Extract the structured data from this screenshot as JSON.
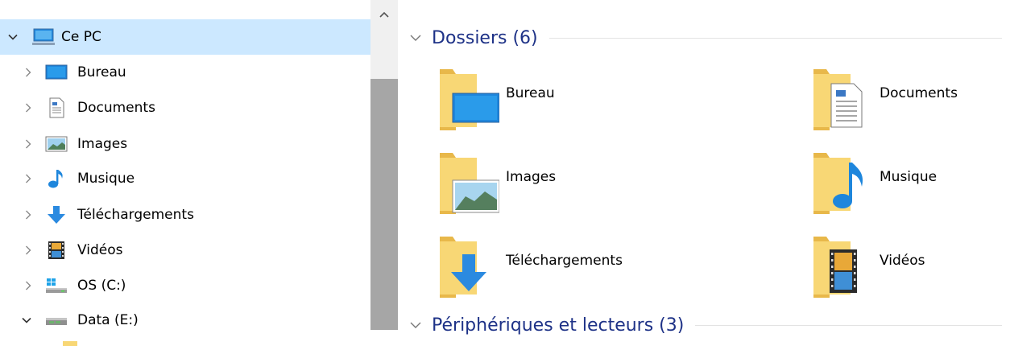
{
  "nav": {
    "items": [
      {
        "label": "Ce PC",
        "expanded": true,
        "selected": true,
        "icon": "computer-icon",
        "level": 0
      },
      {
        "label": "Bureau",
        "expanded": false,
        "icon": "desktop-icon",
        "level": 1
      },
      {
        "label": "Documents",
        "expanded": false,
        "icon": "document-icon",
        "level": 1
      },
      {
        "label": "Images",
        "expanded": false,
        "icon": "picture-icon",
        "level": 1
      },
      {
        "label": "Musique",
        "expanded": false,
        "icon": "music-note-icon",
        "level": 1
      },
      {
        "label": "Téléchargements",
        "expanded": false,
        "icon": "download-arrow-icon",
        "level": 1
      },
      {
        "label": "Vidéos",
        "expanded": false,
        "icon": "film-strip-icon",
        "level": 1
      },
      {
        "label": "OS (C:)",
        "expanded": false,
        "icon": "windows-drive-icon",
        "level": 1
      },
      {
        "label": "Data (E:)",
        "expanded": true,
        "icon": "hard-drive-icon",
        "level": 1
      }
    ]
  },
  "content": {
    "groups": [
      {
        "title": "Dossiers (6)",
        "expanded": true,
        "items": [
          {
            "label": "Bureau",
            "overlay": "desktop-icon"
          },
          {
            "label": "Documents",
            "overlay": "document-icon"
          },
          {
            "label": "Images",
            "overlay": "picture-icon"
          },
          {
            "label": "Musique",
            "overlay": "music-note-icon"
          },
          {
            "label": "Téléchargements",
            "overlay": "download-arrow-icon"
          },
          {
            "label": "Vidéos",
            "overlay": "film-strip-icon"
          }
        ]
      },
      {
        "title": "Périphériques et lecteurs (3)",
        "expanded": true,
        "items": []
      }
    ]
  },
  "colors": {
    "selection": "#cce8ff",
    "group_title": "#1e3287",
    "folder": "#f8d775",
    "folder_back": "#e8b84a",
    "accent_blue": "#1e86dc",
    "scroll_thumb": "#a6a6a6",
    "scroll_track": "#f0f0f0"
  }
}
